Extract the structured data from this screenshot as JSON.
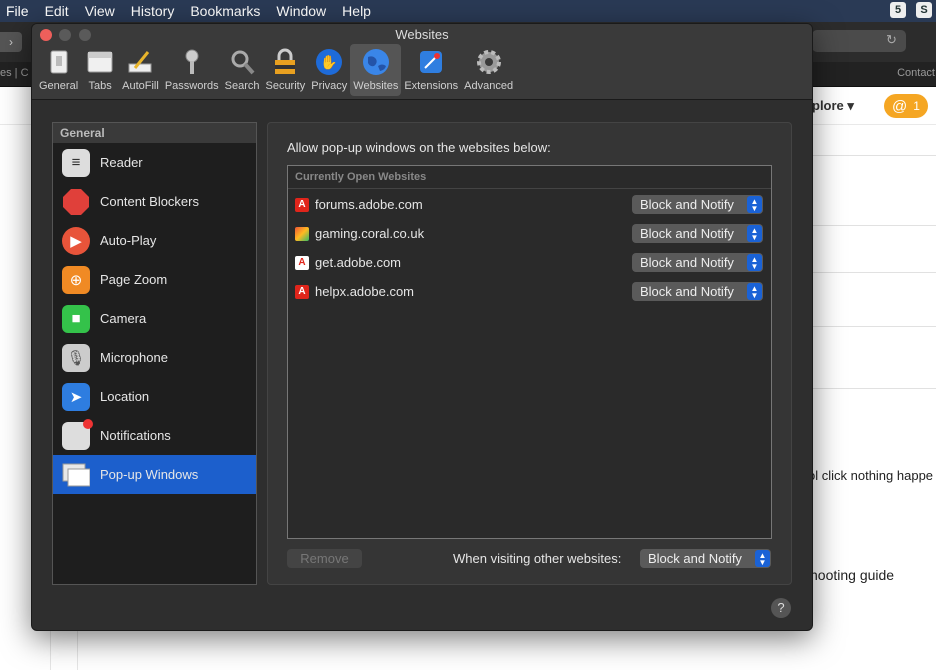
{
  "menubar": {
    "items": [
      "File",
      "Edit",
      "View",
      "History",
      "Bookmarks",
      "Window",
      "Help"
    ],
    "tray": [
      "5",
      "S"
    ]
  },
  "background": {
    "tab_left": "es | C",
    "tab_contact": "Contact",
    "explore": "plore",
    "badge_count": "1",
    "text_line1": "ol click nothing happe",
    "text_line2": "hooting guide"
  },
  "window": {
    "title": "Websites",
    "toolbar": [
      {
        "label": "General"
      },
      {
        "label": "Tabs"
      },
      {
        "label": "AutoFill"
      },
      {
        "label": "Passwords"
      },
      {
        "label": "Search"
      },
      {
        "label": "Security"
      },
      {
        "label": "Privacy"
      },
      {
        "label": "Websites",
        "active": true
      },
      {
        "label": "Extensions"
      },
      {
        "label": "Advanced"
      }
    ],
    "sidebar": {
      "header": "General",
      "items": [
        {
          "label": "Reader",
          "icon": "reader-icon"
        },
        {
          "label": "Content Blockers",
          "icon": "stop-icon"
        },
        {
          "label": "Auto-Play",
          "icon": "play-icon"
        },
        {
          "label": "Page Zoom",
          "icon": "zoom-icon"
        },
        {
          "label": "Camera",
          "icon": "camera-icon"
        },
        {
          "label": "Microphone",
          "icon": "microphone-icon"
        },
        {
          "label": "Location",
          "icon": "location-icon"
        },
        {
          "label": "Notifications",
          "icon": "notifications-icon"
        },
        {
          "label": "Pop-up Windows",
          "icon": "popup-icon",
          "selected": true
        }
      ]
    },
    "panel": {
      "title": "Allow pop-up windows on the websites below:",
      "list_header": "Currently Open Websites",
      "sites": [
        {
          "domain": "forums.adobe.com",
          "setting": "Block and Notify"
        },
        {
          "domain": "gaming.coral.co.uk",
          "setting": "Block and Notify"
        },
        {
          "domain": "get.adobe.com",
          "setting": "Block and Notify"
        },
        {
          "domain": "helpx.adobe.com",
          "setting": "Block and Notify"
        }
      ],
      "remove_label": "Remove",
      "other_label": "When visiting other websites:",
      "other_setting": "Block and Notify"
    },
    "help_label": "?"
  }
}
